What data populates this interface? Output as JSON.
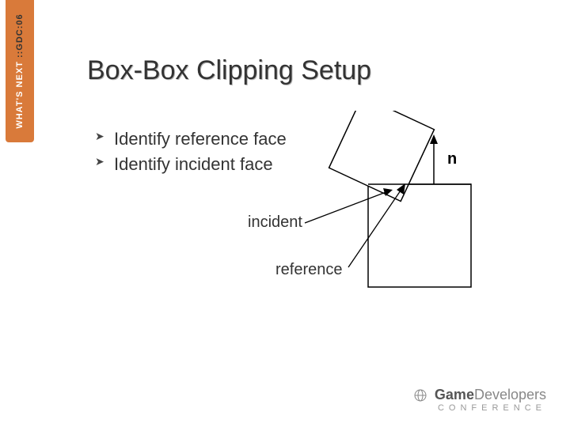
{
  "sidebar": {
    "brand_line1": "WHAT'S",
    "brand_line2": "NEXT",
    "gdc_label": "::GDC:06"
  },
  "slide": {
    "title": "Box-Box Clipping Setup",
    "bullets": [
      "Identify reference face",
      "Identify incident face"
    ]
  },
  "diagram": {
    "label_incident": "incident",
    "label_reference": "reference",
    "label_normal": "n"
  },
  "footer": {
    "brand_prefix": "Game",
    "brand_suffix": "Developers",
    "brand_sub": "CONFERENCE"
  }
}
